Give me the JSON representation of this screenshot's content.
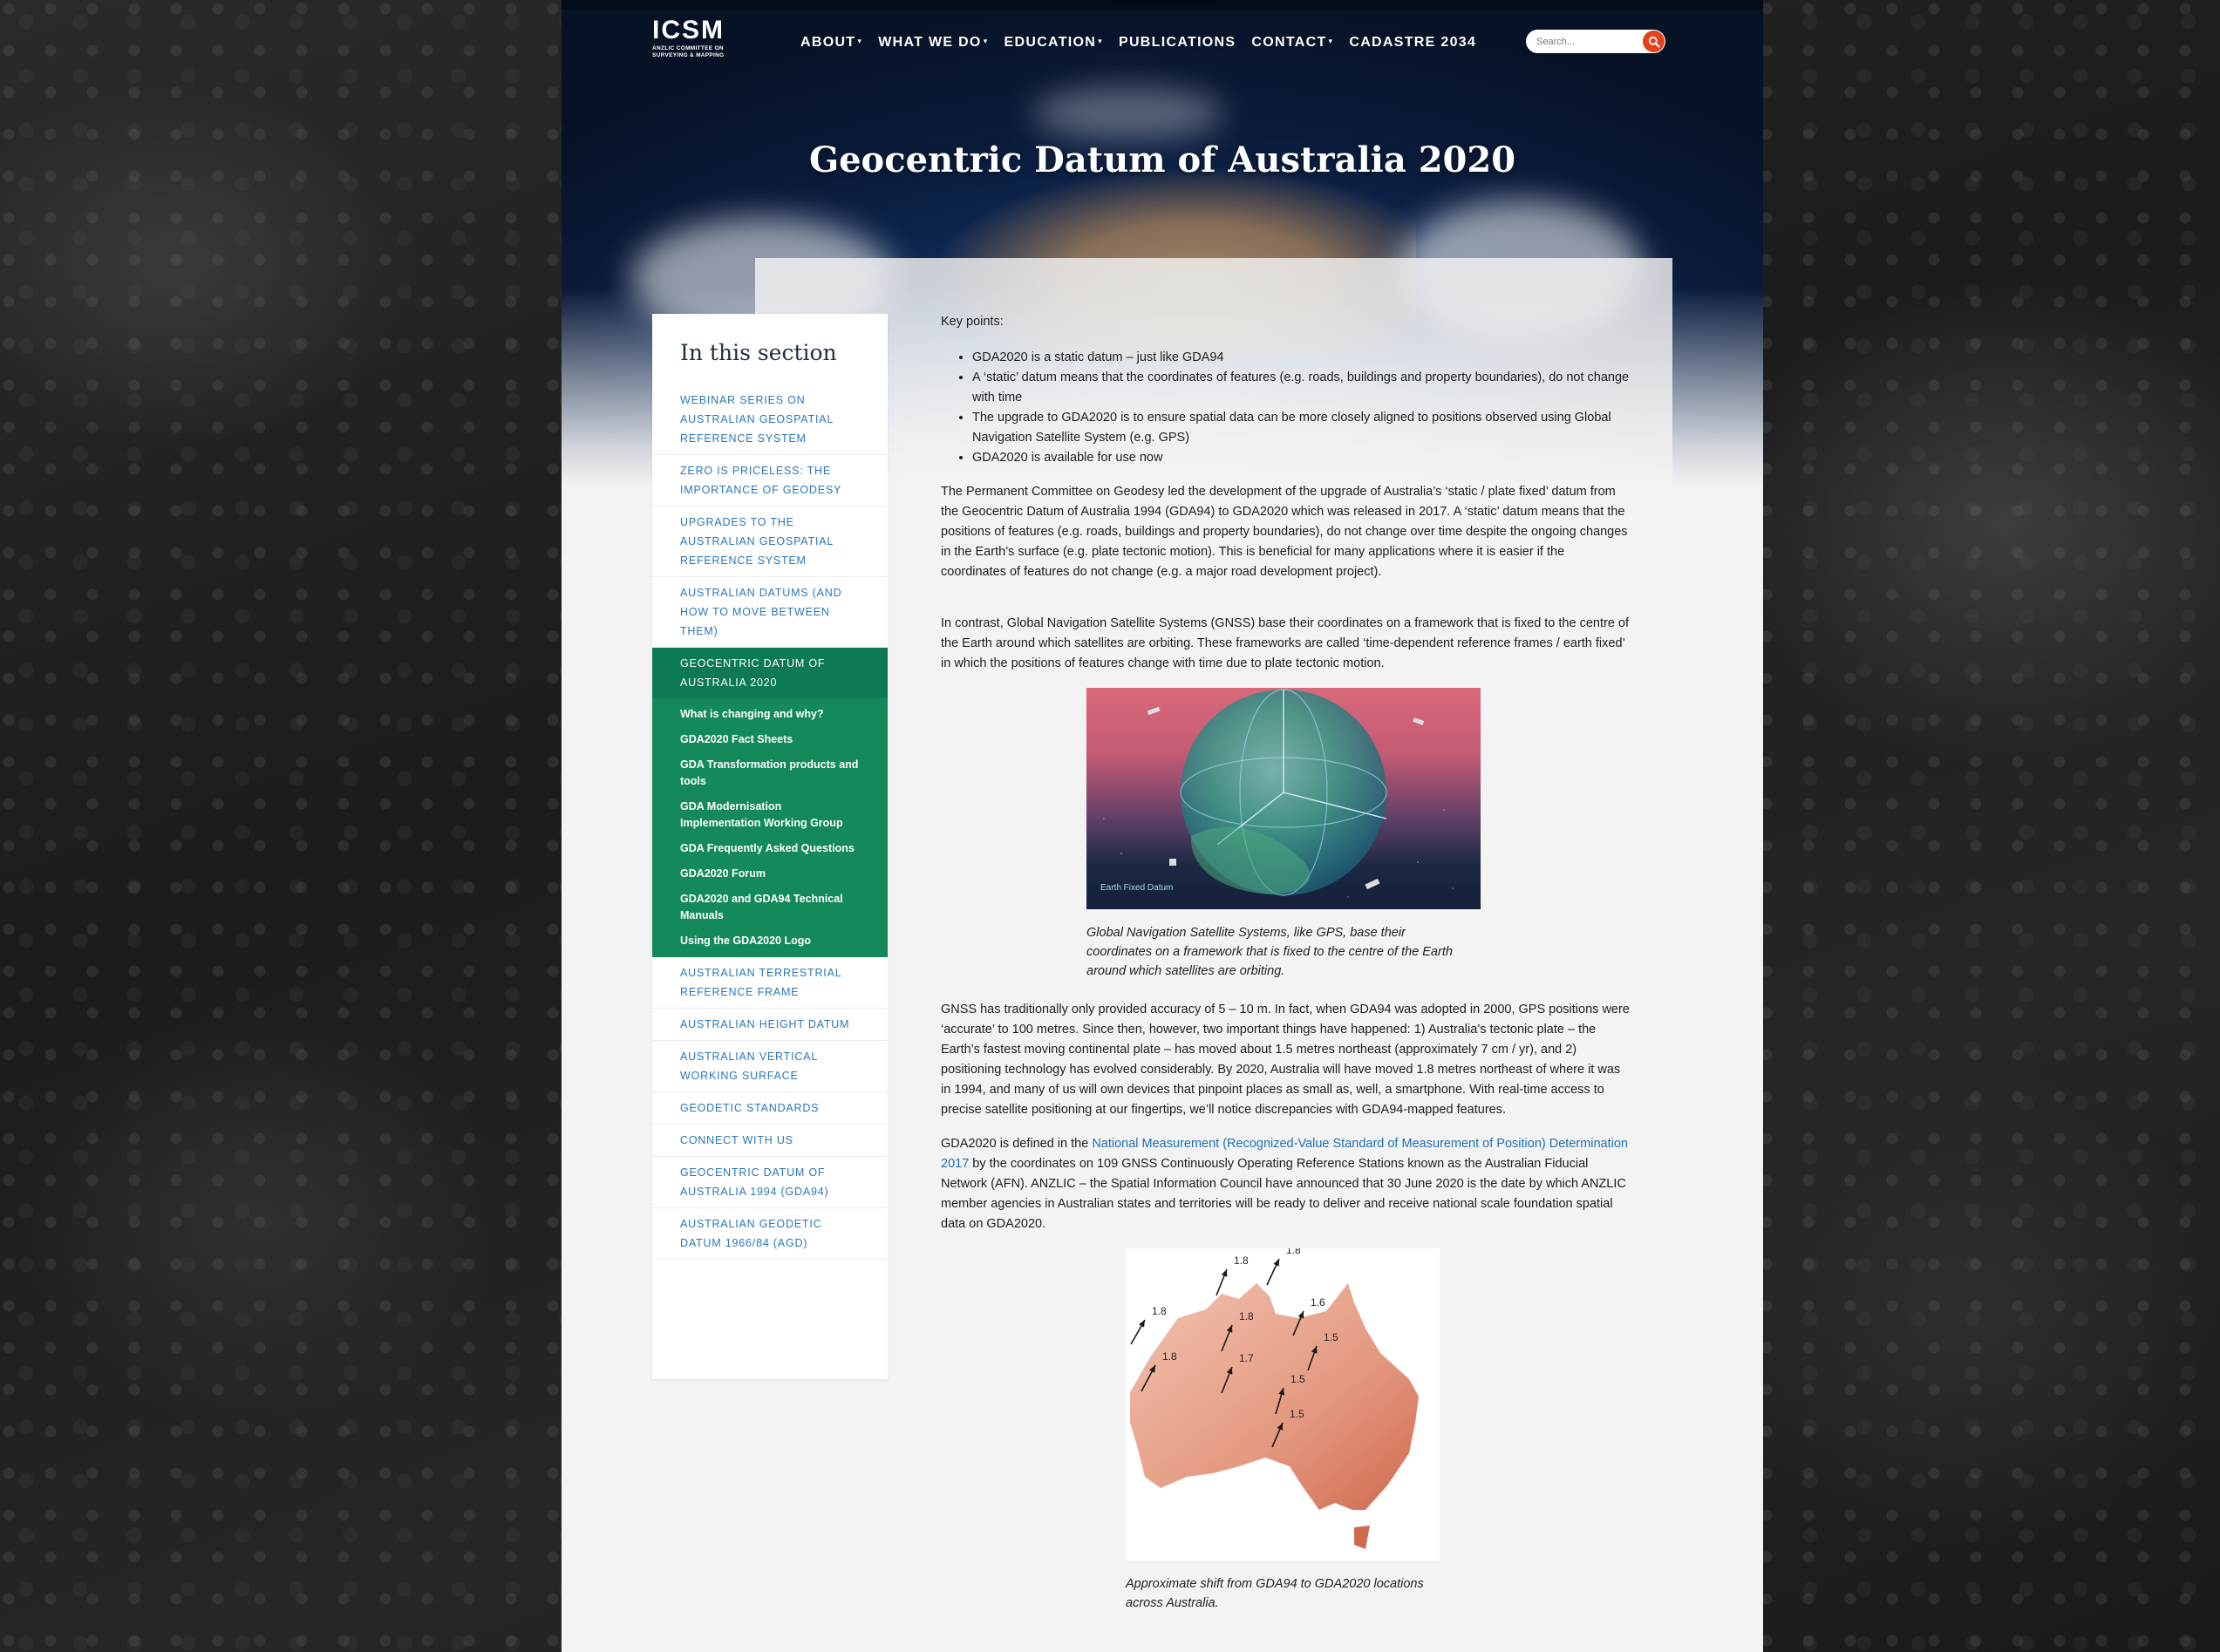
{
  "logo": {
    "mark": "ICSM",
    "sub": "ANZLIC COMMITTEE ON SURVEYING & MAPPING"
  },
  "nav": {
    "items": [
      {
        "label": "ABOUT",
        "dropdown": true
      },
      {
        "label": "WHAT WE DO",
        "dropdown": true
      },
      {
        "label": "EDUCATION",
        "dropdown": true
      },
      {
        "label": "PUBLICATIONS",
        "dropdown": false
      },
      {
        "label": "CONTACT",
        "dropdown": true
      },
      {
        "label": "CADASTRE 2034",
        "dropdown": false
      }
    ],
    "caret": "▾"
  },
  "search": {
    "placeholder": "Search..."
  },
  "page_title": "Geocentric Datum of Australia 2020",
  "sidebar": {
    "title": "In this section",
    "items_top": [
      "WEBINAR SERIES ON AUSTRALIAN GEOSPATIAL REFERENCE SYSTEM",
      "ZERO IS PRICELESS: THE IMPORTANCE OF GEODESY",
      "UPGRADES TO THE AUSTRALIAN GEOSPATIAL REFERENCE SYSTEM",
      "AUSTRALIAN DATUMS (AND HOW TO MOVE BETWEEN THEM)"
    ],
    "active": "GEOCENTRIC DATUM OF AUSTRALIA 2020",
    "sub_items": [
      "What is changing and why?",
      "GDA2020 Fact Sheets",
      "GDA Transformation products and tools",
      "GDA Modernisation Implementation Working Group",
      "GDA Frequently Asked Questions",
      "GDA2020 Forum",
      "GDA2020 and GDA94 Technical Manuals",
      "Using the GDA2020 Logo"
    ],
    "items_bottom": [
      "AUSTRALIAN TERRESTRIAL REFERENCE FRAME",
      "AUSTRALIAN HEIGHT DATUM",
      "AUSTRALIAN VERTICAL WORKING SURFACE",
      "GEODETIC STANDARDS",
      "CONNECT WITH US",
      "GEOCENTRIC DATUM OF AUSTRALIA 1994 (GDA94)",
      "AUSTRALIAN GEODETIC DATUM 1966/84 (AGD)"
    ]
  },
  "article": {
    "key_points_label": "Key points:",
    "bullets": [
      "GDA2020 is a static datum – just like GDA94",
      "A ‘static’ datum means that the coordinates of features (e.g. roads, buildings and property boundaries), do not change with time",
      "The upgrade to GDA2020 is to ensure spatial data can be more closely aligned to positions observed using Global Navigation Satellite System (e.g. GPS)",
      "GDA2020 is available for use now"
    ],
    "para1": "The Permanent Committee on Geodesy led the development of the upgrade of Australia’s ‘static / plate fixed’ datum from the Geocentric Datum of Australia 1994 (GDA94) to GDA2020 which was released in 2017. A ‘static’ datum means that the positions of features (e.g. roads, buildings and property boundaries), do not change over time despite the ongoing changes in the Earth’s surface (e.g. plate tectonic motion). This is beneficial for many applications where it is easier if the coordinates of features do not change (e.g. a major road development project).",
    "para2": "In contrast, Global Navigation Satellite Systems (GNSS) base their coordinates on a framework that is fixed to the centre of the Earth around which satellites are orbiting. These frameworks are called ‘time-dependent reference frames / earth fixed’ in which the positions of features change with time due to plate tectonic motion.",
    "fig1_label": "Earth Fixed Datum",
    "fig1_caption": "Global Navigation Satellite Systems, like GPS, base their coordinates on a framework that is fixed to the centre of the Earth around which satellites are orbiting.",
    "para3": "GNSS has traditionally only provided accuracy of 5 – 10 m. In fact, when GDA94 was adopted in 2000, GPS positions were ‘accurate’ to 100 metres. Since then, however, two important things have happened: 1) Australia’s tectonic plate – the Earth’s fastest moving continental plate – has moved about 1.5 metres northeast (approximately 7 cm / yr), and 2) positioning technology has evolved considerably. By 2020, Australia will have moved 1.8 metres northeast of where it was in 1994, and many of us will own devices that pinpoint places as small as, well, a smartphone. With real-time access to precise satellite positioning at our fingertips, we’ll notice discrepancies with GDA94-mapped features.",
    "para4_pre": "GDA2020 is defined in the ",
    "para4_link": "National Measurement (Recognized-Value Standard of Measurement of Position) Determination 2017",
    "para4_post": " by the coordinates on 109 GNSS Continuously Operating Reference Stations known as the Australian Fiducial Network (AFN). ANZLIC – the Spatial Information Council have announced that 30 June 2020 is the date by which ANZLIC member agencies in Australian states and territories will be ready to deliver and receive national scale foundation spatial data on GDA2020.",
    "fig2_labels": [
      "1.8",
      "1.8",
      "1.8",
      "1.6",
      "1.8",
      "1.5",
      "1.8",
      "1.7",
      "1.5",
      "1.5"
    ],
    "fig2_caption": "Approximate shift from GDA94 to GDA2020 locations across Australia."
  },
  "colors": {
    "link": "#2a76b8",
    "active_bg": "#0e7a55",
    "sub_bg": "#13895c",
    "search_button": "#e0441c"
  }
}
